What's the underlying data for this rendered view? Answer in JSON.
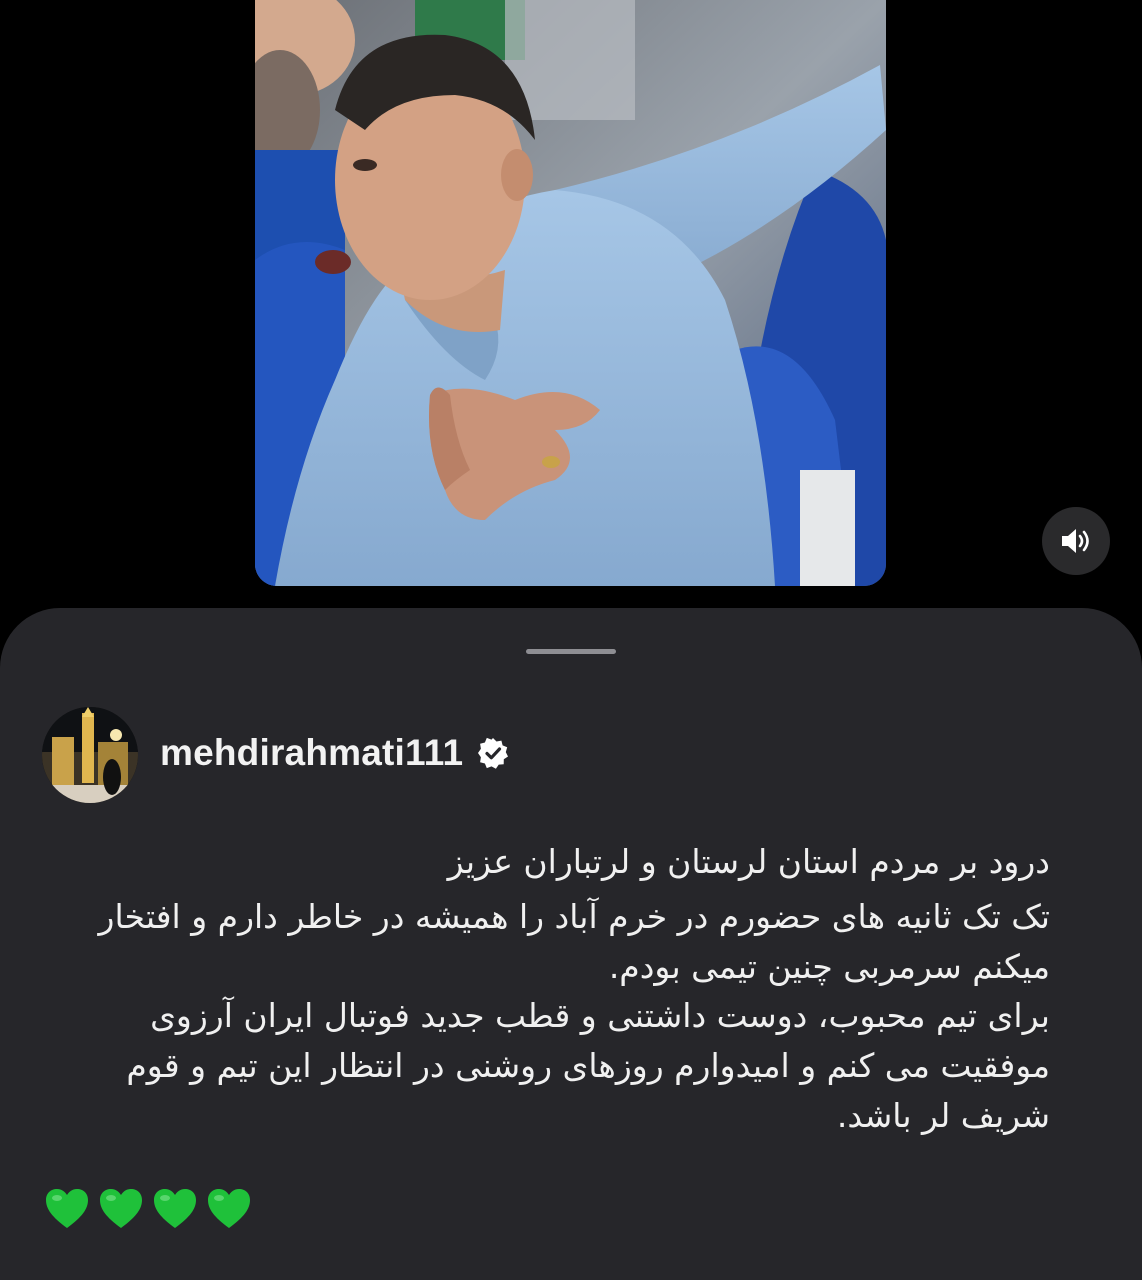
{
  "post": {
    "username": "mehdirahmati111",
    "verified": true,
    "caption": {
      "paragraph1": "درود  بر مردم استان لرستان و لرتباران  عزیز",
      "paragraph2": "تک تک ثانیه های حضورم در خرم  آباد را همیشه در خاطر دارم و افتخار میکنم سرمربی چنین تیمی بودم.",
      "paragraph3": "برای  تیم محبوب، دوست داشتنی  و قطب جدید فوتبال ایران آرزوی موفقیت می کنم  و امیدوارم روزهای روشنی در انتظار این تیم و  قوم شریف لر باشد."
    },
    "emoji_hearts": [
      "💚",
      "💚",
      "💚",
      "💚"
    ]
  },
  "icons": {
    "sound": "speaker-on-icon",
    "verified": "verified-badge-icon"
  },
  "colors": {
    "background": "#000000",
    "sheet": "#26262a",
    "text": "#f0f0f0",
    "heart": "#1fc13a",
    "sound_button": "#2a2a2c"
  }
}
